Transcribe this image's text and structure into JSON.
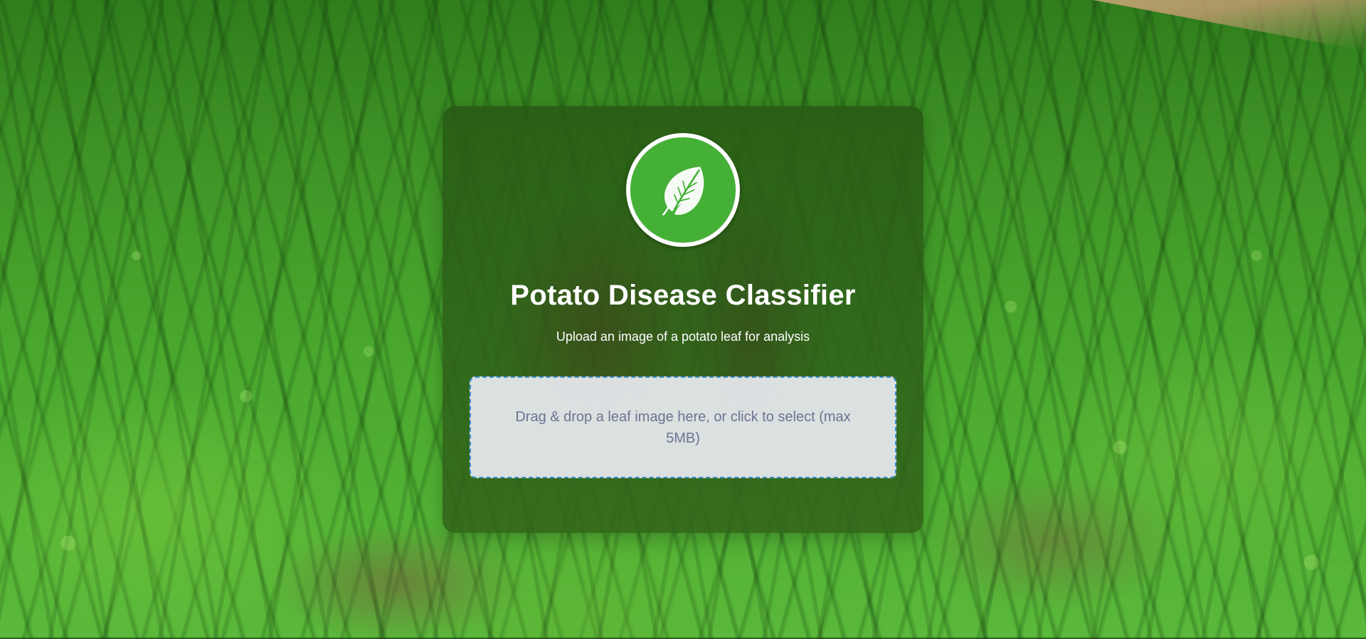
{
  "page": {
    "title": "Potato Disease Classifier",
    "subtitle": "Upload an image of a potato leaf for analysis"
  },
  "logo": {
    "icon": "leaf-icon",
    "ring_color": "#ffffff",
    "fill_color": "#44b036"
  },
  "dropzone": {
    "text": "Drag & drop a leaf image here, or click to select (max 5MB)",
    "border_color": "#3d8fd1"
  },
  "background": {
    "description_icon": "potato-field-photo"
  }
}
